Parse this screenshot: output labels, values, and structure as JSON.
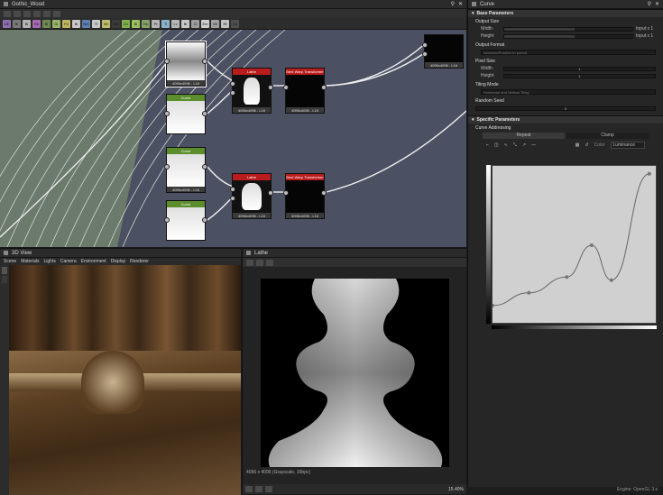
{
  "graph": {
    "tab_title": "Gothic_Wood",
    "chips": [
      {
        "label": "UE",
        "color": "#8e6fb0"
      },
      {
        "label": "Bl",
        "color": "#7a7a7a"
      },
      {
        "label": "Bl",
        "color": "#b4b4b4"
      },
      {
        "label": "Sh",
        "color": "#a46ab3"
      },
      {
        "label": "Bl",
        "color": "#6d8a51"
      },
      {
        "label": "Gr",
        "color": "#9ab36a"
      },
      {
        "label": "Fx",
        "color": "#c0b45f"
      },
      {
        "label": "Bl",
        "color": "#c9c9c9"
      },
      {
        "label": "Nm",
        "color": "#5f7fb4"
      },
      {
        "label": "Tf",
        "color": "#c9c9c9"
      },
      {
        "label": "Wr",
        "color": "#bdbd6a"
      },
      {
        "label": "Ao",
        "color": "#3a3a3a"
      },
      {
        "label": "Cv",
        "color": "#7fb04b"
      },
      {
        "label": "Bl",
        "color": "#9bbf5c"
      },
      {
        "label": "Hs",
        "color": "#88a06a"
      },
      {
        "label": "Pt",
        "color": "#b6b6b6"
      },
      {
        "label": "Tl",
        "color": "#8bb0c9"
      },
      {
        "label": "Lv",
        "color": "#b7b7b7"
      },
      {
        "label": "Bl",
        "color": "#c8c8c8"
      },
      {
        "label": "Cl",
        "color": "#9d9d9d"
      },
      {
        "label": "Em",
        "color": "#cfcfcf"
      },
      {
        "label": "Mt",
        "color": "#a0a0a0"
      },
      {
        "label": "Rf",
        "color": "#c3c3c3"
      },
      {
        "label": "Gn",
        "color": "#4f4f4f"
      }
    ],
    "search_placeholder": "Search Node...",
    "nodes": {
      "top_gradient": {
        "header": "",
        "caption": "4096x4096 - L16",
        "color": "#7ab24a"
      },
      "curve1": {
        "header": "Curve",
        "caption": "4096x4096 - L16",
        "color": "#5c8d2d"
      },
      "lathe1": {
        "header": "Lathe",
        "caption": "4096x4096 - L16",
        "color": "#b81c1c"
      },
      "xform1": {
        "header": "Bent Warp Transformer",
        "caption": "4096x4096 - L16",
        "color": "#b81c1c"
      },
      "curve2": {
        "header": "Curve",
        "caption": "4096x4096 - L16",
        "color": "#5c8d2d"
      },
      "curve3": {
        "header": "Curve",
        "caption": "4096x4096 - L16",
        "color": "#5c8d2d"
      },
      "lathe2": {
        "header": "Lathe",
        "caption": "4096x4096 - L16",
        "color": "#b81c1c"
      },
      "xform2": {
        "header": "Bent Warp Transformer",
        "caption": "4096x4096 - L16",
        "color": "#b81c1c"
      },
      "output_node": {
        "header": "",
        "caption": "4096x4096 - L16",
        "color": "#5f5f5f"
      }
    }
  },
  "props": {
    "tab_title": "Curve",
    "base_section": "Base Parameters",
    "output_size": {
      "label": "Output Size",
      "width_label": "Width",
      "width_value": "0",
      "width_suffix": "Input x 1",
      "height_label": "Height",
      "height_value": "0",
      "height_suffix": "Input x 1"
    },
    "output_format": {
      "label": "Output Format",
      "value": "Absolute/Relative to parent"
    },
    "pixel_size": {
      "label": "Pixel Size",
      "width_label": "Width",
      "width_value": "1",
      "height_label": "Height",
      "height_value": "1"
    },
    "tiling_mode": {
      "label": "Tiling Mode",
      "value": "Horizontal and Vertical Tiling"
    },
    "random_seed": {
      "label": "Random Seed",
      "value": "0"
    },
    "specific_section": "Specific Parameters",
    "curve_addressing": {
      "label": "Curve Addressing",
      "options": [
        "Repeat",
        "Clamp"
      ],
      "selected": "Clamp"
    },
    "channel_mode": {
      "label": "Color",
      "value": "Luminance"
    },
    "curve_points": [
      [
        0.0,
        0.12
      ],
      [
        0.22,
        0.2
      ],
      [
        0.45,
        0.3
      ],
      [
        0.6,
        0.5
      ],
      [
        0.72,
        0.28
      ],
      [
        0.95,
        0.95
      ]
    ]
  },
  "view3d": {
    "tab_title": "3D View",
    "menu": [
      "Scene",
      "Materials",
      "Lights",
      "Camera",
      "Environment",
      "Display",
      "Renderer"
    ]
  },
  "lathe_view": {
    "tab_title": "Lathe",
    "info": "4096 x 4096 (Grayscale, 16bpc)",
    "zoom": "15.40%"
  },
  "statusbar": {
    "engine": "Engine: OpenGL 3.x"
  }
}
